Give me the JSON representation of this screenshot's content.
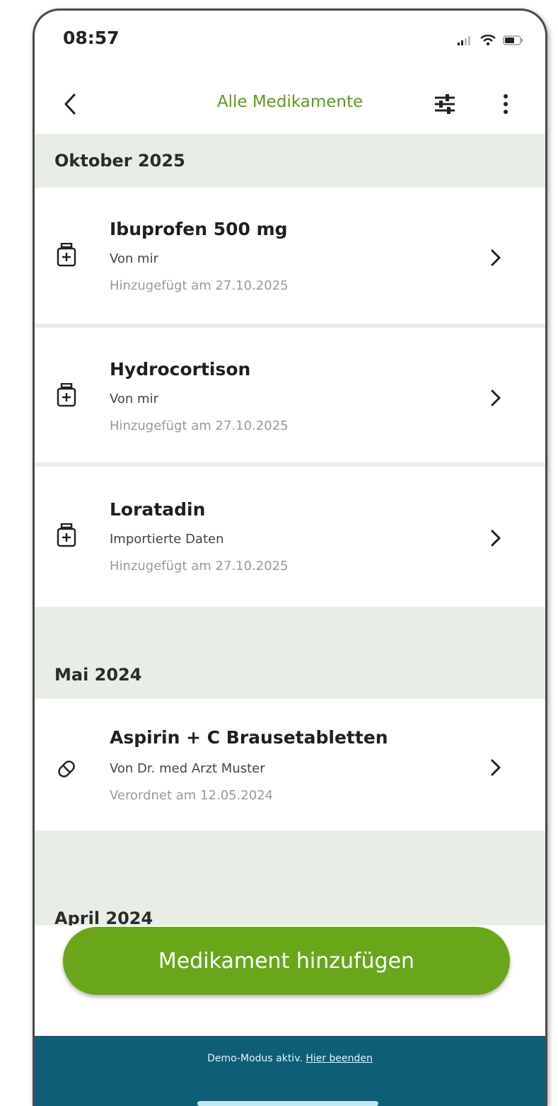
{
  "status_bar": {
    "time": "08:57"
  },
  "header": {
    "title": "Alle Medikamente",
    "back_icon": "chevron-left-icon",
    "filter_icon": "sliders-icon",
    "more_icon": "more-vertical-icon"
  },
  "sections": [
    {
      "label": "Oktober 2025",
      "items": [
        {
          "name": "Ibuprofen 500 mg",
          "source": "Von mir",
          "date": "Hinzugefügt am 27.10.2025",
          "icon": "medicine-bottle-icon"
        },
        {
          "name": "Hydrocortison",
          "source": "Von mir",
          "date": "Hinzugefügt am 27.10.2025",
          "icon": "medicine-bottle-icon"
        },
        {
          "name": "Loratadin",
          "source": "Importierte Daten",
          "date": "Hinzugefügt am 27.10.2025",
          "icon": "medicine-bottle-icon"
        }
      ]
    },
    {
      "label": "Mai 2024",
      "items": [
        {
          "name": "Aspirin + C Brausetabletten",
          "source": "Von Dr. med Arzt Muster",
          "date": "Verordnet am 12.05.2024",
          "icon": "pill-icon"
        }
      ]
    },
    {
      "label": "April 2024",
      "items": []
    }
  ],
  "add_button": {
    "label": "Medikament hinzufügen"
  },
  "demo_bar": {
    "text": "Demo-Modus aktiv.",
    "link": "Hier beenden"
  },
  "colors": {
    "accent_green": "#6aa61a",
    "title_green": "#5e9a1f",
    "section_background": "#e8eee6",
    "demo_bar": "#0e5e78"
  }
}
